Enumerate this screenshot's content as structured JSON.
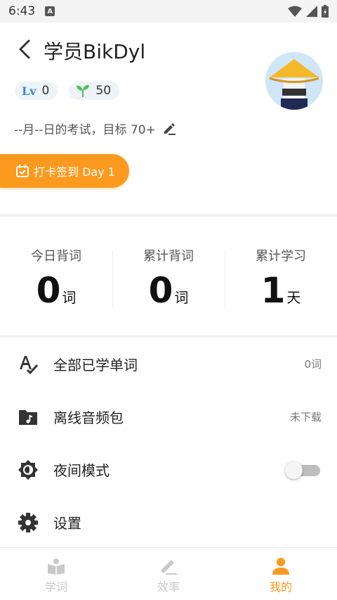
{
  "status_bar": {
    "time": "6:43",
    "notification_icon": "A"
  },
  "header": {
    "title": "学员BikDyl",
    "level_prefix": "Lv",
    "level_value": "0",
    "seeds_value": "50",
    "exam_text": "--月--日的考试，目标 70+",
    "checkin_label": "打卡签到 Day 1"
  },
  "stats": [
    {
      "label": "今日背词",
      "value": "0",
      "unit": "词"
    },
    {
      "label": "累计背词",
      "value": "0",
      "unit": "词"
    },
    {
      "label": "累计学习",
      "value": "1",
      "unit": "天"
    }
  ],
  "menu": {
    "all_words": {
      "label": "全部已学单词",
      "value": "0词"
    },
    "offline_audio": {
      "label": "离线音频包",
      "value": "未下载"
    },
    "night_mode": {
      "label": "夜间模式",
      "enabled": false
    },
    "settings": {
      "label": "设置"
    }
  },
  "tabs": [
    {
      "label": "学词",
      "icon": "book-icon",
      "active": false
    },
    {
      "label": "效率",
      "icon": "pencil-icon",
      "active": false
    },
    {
      "label": "我的",
      "icon": "person-icon",
      "active": true
    }
  ],
  "colors": {
    "accent": "#fb9a1e",
    "level_blue": "#3d86d6",
    "seed_green": "#4cbf55",
    "inactive_tab": "#c8c8c8"
  }
}
